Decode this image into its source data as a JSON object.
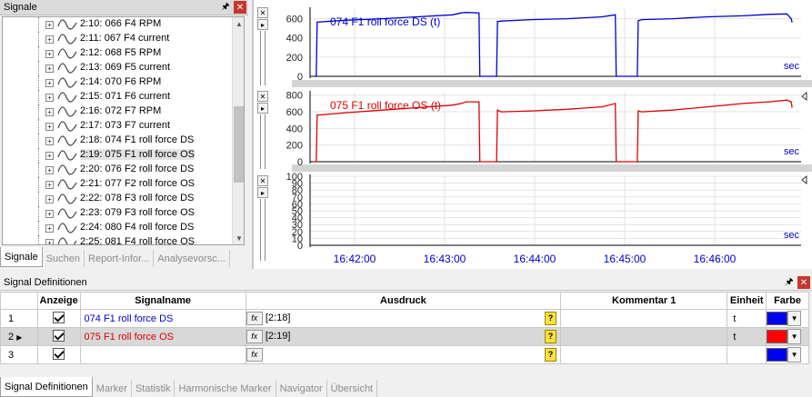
{
  "signale_panel": {
    "title": "Signale",
    "items": [
      {
        "id": "2:10:",
        "name": "066 F4 RPM"
      },
      {
        "id": "2:11:",
        "name": "067 F4 current"
      },
      {
        "id": "2:12:",
        "name": "068 F5 RPM"
      },
      {
        "id": "2:13:",
        "name": "069 F5 current"
      },
      {
        "id": "2:14:",
        "name": "070 F6 RPM"
      },
      {
        "id": "2:15:",
        "name": "071 F6 current"
      },
      {
        "id": "2:16:",
        "name": "072 F7 RPM"
      },
      {
        "id": "2:17:",
        "name": "073 F7 current"
      },
      {
        "id": "2:18:",
        "name": "074 F1 roll force DS"
      },
      {
        "id": "2:19:",
        "name": "075 F1 roll force OS"
      },
      {
        "id": "2:20:",
        "name": "076 F2 roll force DS"
      },
      {
        "id": "2:21:",
        "name": "077 F2 roll force OS"
      },
      {
        "id": "2:22:",
        "name": "078 F3 roll force DS"
      },
      {
        "id": "2:23:",
        "name": "079 F3 roll force OS"
      },
      {
        "id": "2:24:",
        "name": "080 F4 roll force DS"
      },
      {
        "id": "2:25:",
        "name": "081 F4 roll force OS"
      }
    ],
    "selected_index": 9,
    "tabs": [
      "Signale",
      "Suchen",
      "Report-Infor...",
      "Analysevorsc..."
    ]
  },
  "chart_data": [
    {
      "type": "line",
      "title": "074 F1 roll force DS (t)",
      "unit_label": "sec",
      "color": "#0000cc",
      "ylim": [
        0,
        700
      ],
      "yticks": [
        0,
        200,
        400,
        600
      ],
      "x": [
        2,
        5,
        6,
        40,
        80,
        120,
        160,
        170,
        175,
        190,
        191,
        210,
        211,
        215,
        250,
        290,
        330,
        345,
        346,
        370,
        371,
        375,
        410,
        450,
        490,
        520,
        540,
        545,
        546
      ],
      "y": [
        0,
        0,
        565,
        585,
        600,
        620,
        640,
        660,
        665,
        660,
        0,
        0,
        570,
        575,
        590,
        600,
        620,
        640,
        0,
        0,
        580,
        590,
        600,
        620,
        630,
        645,
        650,
        600,
        560
      ]
    },
    {
      "type": "line",
      "title": "075 F1 roll force OS (t)",
      "unit_label": "sec",
      "color": "#dd0000",
      "ylim": [
        0,
        830
      ],
      "yticks": [
        0,
        200,
        400,
        600,
        800
      ],
      "x": [
        2,
        5,
        6,
        40,
        80,
        120,
        160,
        170,
        175,
        190,
        191,
        210,
        211,
        215,
        250,
        290,
        330,
        345,
        346,
        370,
        371,
        375,
        410,
        450,
        490,
        520,
        540,
        545,
        546
      ],
      "y": [
        0,
        0,
        560,
        590,
        620,
        650,
        680,
        700,
        720,
        720,
        0,
        0,
        620,
        600,
        610,
        630,
        660,
        700,
        0,
        0,
        610,
        600,
        620,
        660,
        700,
        720,
        740,
        720,
        650
      ]
    },
    {
      "type": "line",
      "unit_label": "sec",
      "ylim": [
        0,
        100
      ],
      "yticks": [
        0,
        10,
        20,
        30,
        40,
        50,
        60,
        70,
        80,
        90,
        100
      ],
      "xticks": [
        "16:42:00",
        "16:43:00",
        "16:44:00",
        "16:45:00",
        "16:46:00"
      ],
      "x": [],
      "y": []
    }
  ],
  "definitions": {
    "title": "Signal Definitionen",
    "columns": [
      "Anzeige",
      "Signalname",
      "Ausdruck",
      "Kommentar 1",
      "Einheit",
      "Farbe"
    ],
    "rows": [
      {
        "num": "1",
        "name": "074 F1 roll force DS",
        "expr": "[2:18]",
        "unit": "t",
        "color": "#0000ee",
        "name_color": "#0000cc"
      },
      {
        "num": "2",
        "name": "075 F1 roll force OS",
        "expr": "[2:19]",
        "unit": "t",
        "color": "#ff0000",
        "name_color": "#dd0000"
      },
      {
        "num": "3",
        "name": "",
        "expr": "",
        "unit": "",
        "color": "#0000ee",
        "name_color": "#000000"
      }
    ],
    "tabs": [
      "Signal Definitionen",
      "Marker",
      "Statistik",
      "Harmonische Marker",
      "Navigator",
      "Übersicht"
    ]
  }
}
